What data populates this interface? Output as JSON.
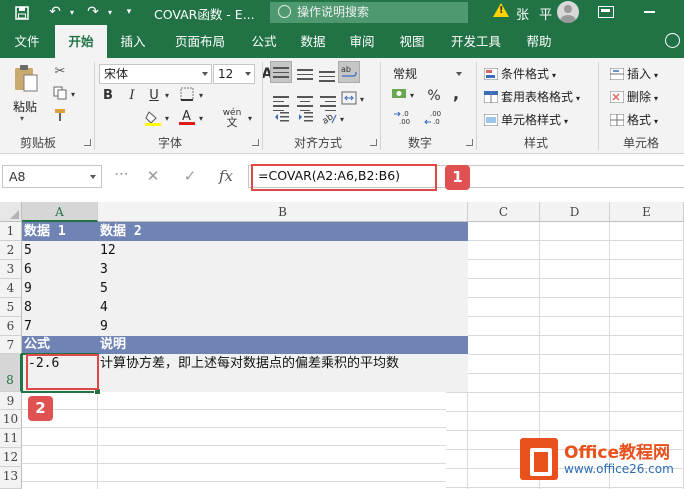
{
  "window": {
    "doc_title": "COVAR函数 - E...",
    "tell_me": "操作说明搜索",
    "user_name": "张 平"
  },
  "tabs": [
    {
      "label": "文件",
      "active": false
    },
    {
      "label": "开始",
      "active": true
    },
    {
      "label": "插入",
      "active": false
    },
    {
      "label": "页面布局",
      "active": false
    },
    {
      "label": "公式",
      "active": false
    },
    {
      "label": "数据",
      "active": false
    },
    {
      "label": "审阅",
      "active": false
    },
    {
      "label": "视图",
      "active": false
    },
    {
      "label": "开发工具",
      "active": false
    },
    {
      "label": "帮助",
      "active": false
    }
  ],
  "ribbon": {
    "clipboard": {
      "paste_label": "粘贴",
      "group_label": "剪贴板"
    },
    "font": {
      "name": "宋体",
      "size": "12",
      "bold": "B",
      "italic": "I",
      "underline": "U",
      "size_up": "A",
      "size_down": "A",
      "wen": "wén",
      "group_label": "字体"
    },
    "alignment": {
      "group_label": "对齐方式"
    },
    "number": {
      "format": "常规",
      "percent": "%",
      "comma": ",",
      "group_label": "数字"
    },
    "styles": {
      "conditional": "条件格式",
      "table": "套用表格格式",
      "cell_styles": "单元格样式",
      "group_label": "样式"
    },
    "cells": {
      "insert": "插入",
      "delete": "删除",
      "format": "格式",
      "group_label": "单元格"
    }
  },
  "formula_bar": {
    "name_box": "A8",
    "cancel": "✕",
    "confirm": "✓",
    "fx": "fx",
    "formula": "=COVAR(A2:A6,B2:B6)"
  },
  "annotations": {
    "badge1": "1",
    "badge2": "2"
  },
  "sheet": {
    "columns": [
      "A",
      "B",
      "C",
      "D",
      "E"
    ],
    "rows": [
      "1",
      "2",
      "3",
      "4",
      "5",
      "6",
      "7",
      "8",
      "9",
      "10",
      "11",
      "12",
      "13"
    ],
    "cells": {
      "A1": "数据 1",
      "B1": "数据 2",
      "A2": "5",
      "B2": "12",
      "A3": "6",
      "B3": "3",
      "A4": "9",
      "B4": "5",
      "A5": "8",
      "B5": "4",
      "A6": "7",
      "B6": "9",
      "A7": "公式",
      "B7": "说明",
      "A8": "-2.6",
      "B8": "计算协方差，即上述每对数据点的偏差乘积的平均数"
    }
  },
  "watermark": {
    "title": "Office教程网",
    "url": "www.office26.com"
  },
  "colors": {
    "excel_green": "#217346",
    "header_fill": "#6f83b4",
    "data_fill": "#f1f1f1",
    "highlight_red": "#e04848",
    "logo_orange": "#e8501c"
  },
  "icons": [
    "save-icon",
    "undo-icon",
    "redo-icon",
    "customize-qat-icon",
    "lightbulb-icon",
    "warning-icon",
    "avatar-icon",
    "ribbon-display-icon",
    "minimize-icon",
    "smiley-icon",
    "cut-icon",
    "copy-icon",
    "format-painter-icon",
    "fill-color-icon",
    "font-color-icon",
    "borders-icon",
    "align-top-icon",
    "align-middle-icon",
    "align-bottom-icon",
    "wrap-text-icon",
    "align-left-icon",
    "align-center-icon",
    "align-right-icon",
    "merge-icon",
    "currency-icon",
    "percent-icon",
    "comma-icon",
    "increase-decimal-icon",
    "decrease-decimal-icon",
    "conditional-format-icon",
    "table-format-icon",
    "cell-styles-icon",
    "insert-cells-icon",
    "delete-cells-icon",
    "format-cells-icon",
    "name-box-dropdown-icon",
    "fx-icon",
    "office-logo-icon"
  ]
}
